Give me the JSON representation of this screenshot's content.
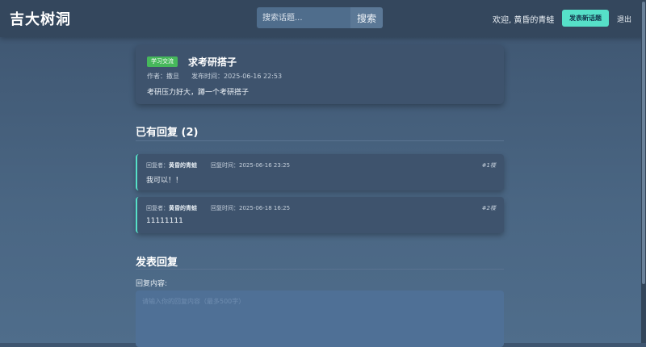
{
  "nav": {
    "brand": "吉大树洞",
    "search_placeholder": "搜索话题...",
    "search_button": "搜索",
    "welcome": "欢迎, 黄昏的青蛙",
    "new_topic_button": "发表新话题",
    "logout": "退出"
  },
  "post": {
    "tag": "学习交流",
    "title": "求考研搭子",
    "author": "作者：撒旦",
    "published": "发布时间：2025-06-16 22:53",
    "body": "考研压力好大，蹲一个考研搭子"
  },
  "replies_section": {
    "title": "已有回复 (2)"
  },
  "replies": [
    {
      "author_label": "回复者：",
      "author": "黄昏的青蛙",
      "time": "回复时间：2025-06-16 23:25",
      "floor": "#1楼",
      "body": "我可以！！"
    },
    {
      "author_label": "回复者：",
      "author": "黄昏的青蛙",
      "time": "回复时间：2025-06-18 16:25",
      "floor": "#2楼",
      "body": "11111111"
    }
  ],
  "reply_form": {
    "title": "发表回复",
    "label": "回复内容:",
    "placeholder": "请输入你的回复内容（最多500字）"
  },
  "colors": {
    "accent": "#56e0c8",
    "tag": "#46b85b",
    "card": "#3e536d",
    "nav": "#34475d"
  }
}
